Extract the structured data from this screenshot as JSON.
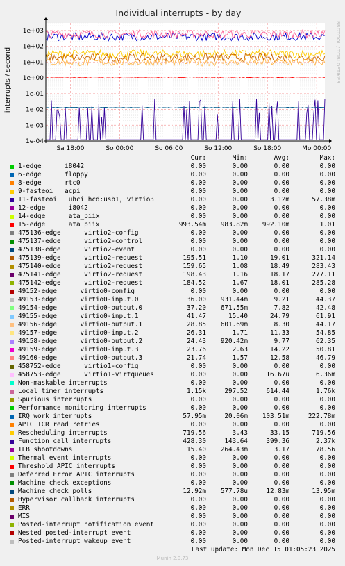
{
  "chart_data": {
    "type": "line",
    "title": "Individual interrupts - by day",
    "ylabel": "interrupts / second",
    "yscale": "log",
    "ylim": [
      0.0001,
      3000
    ],
    "yticks": [
      "1e-04",
      "1e-03",
      "1e-02",
      "1e-01",
      "1e+00",
      "1e+01",
      "1e+02",
      "1e+03"
    ],
    "xticks": [
      "Sa 18:00",
      "So 00:00",
      "So 06:00",
      "So 12:00",
      "So 18:00",
      "Mo 00:00"
    ],
    "xtick_hours": [
      -30,
      -24,
      -18,
      -12,
      -6,
      0
    ],
    "xlim_hours": [
      -33,
      1
    ],
    "approx_series_levels": [
      {
        "name": "15-edge ata_piix",
        "level": 1.0,
        "color": "#ff0000"
      },
      {
        "name": "11-fasteoi uhci_hcd:usb1, virtio3",
        "level": 0.003,
        "color": "#330099",
        "spiky": true
      },
      {
        "name": "Machine check polls",
        "level": 0.013,
        "color": "#005a8c"
      },
      {
        "name": "Function call interrupts",
        "level": 400,
        "color": "#0000cc"
      },
      {
        "name": "Local timer interrupts",
        "level": 600,
        "color": "#ff6699"
      },
      {
        "name": "Rescheduling interrupts",
        "level": 33,
        "color": "#ffcc00"
      },
      {
        "name": "virtio2-request",
        "level": 19,
        "color": "#cc6600"
      },
      {
        "name": "virtio0-input/output",
        "level": 10,
        "color": "#ffb84d"
      }
    ]
  },
  "side_text": "RRDTOOL / TOBI OETIKER",
  "legend_header": {
    "cur": "Cur:",
    "min": "Min:",
    "avg": "Avg:",
    "max": "Max:"
  },
  "legend": [
    {
      "label": "1-edge      i8042",
      "color": "#00cc00",
      "cur": "0.00",
      "min": "0.00",
      "avg": "0.00",
      "max": "0.00"
    },
    {
      "label": "6-edge      floppy",
      "color": "#0066b3",
      "cur": "0.00",
      "min": "0.00",
      "avg": "0.00",
      "max": "0.00"
    },
    {
      "label": "8-edge      rtc0",
      "color": "#ff8000",
      "cur": "0.00",
      "min": "0.00",
      "avg": "0.00",
      "max": "0.00"
    },
    {
      "label": "9-fasteoi   acpi",
      "color": "#ffcc00",
      "cur": "0.00",
      "min": "0.00",
      "avg": "0.00",
      "max": "0.00"
    },
    {
      "label": "11-fasteoi   uhci_hcd:usb1, virtio3",
      "color": "#330099",
      "cur": "0.00",
      "min": "0.00",
      "avg": "3.12m",
      "max": "57.38m"
    },
    {
      "label": "12-edge      i8042",
      "color": "#990099",
      "cur": "0.00",
      "min": "0.00",
      "avg": "0.00",
      "max": "0.00"
    },
    {
      "label": "14-edge      ata_piix",
      "color": "#ccff00",
      "cur": "0.00",
      "min": "0.00",
      "avg": "0.00",
      "max": "0.00"
    },
    {
      "label": "15-edge      ata_piix",
      "color": "#ff0000",
      "cur": "993.54m",
      "min": "983.82m",
      "avg": "992.10m",
      "max": "1.01"
    },
    {
      "label": "475136-edge      virtio2-config",
      "color": "#808080",
      "cur": "0.00",
      "min": "0.00",
      "avg": "0.00",
      "max": "0.00"
    },
    {
      "label": "475137-edge      virtio2-control",
      "color": "#008f00",
      "cur": "0.00",
      "min": "0.00",
      "avg": "0.00",
      "max": "0.00"
    },
    {
      "label": "475138-edge      virtio2-event",
      "color": "#00487d",
      "cur": "0.00",
      "min": "0.00",
      "avg": "0.00",
      "max": "0.00"
    },
    {
      "label": "475139-edge      virtio2-request",
      "color": "#b35a00",
      "cur": "195.51",
      "min": "1.10",
      "avg": "19.01",
      "max": "321.14"
    },
    {
      "label": "475140-edge      virtio2-request",
      "color": "#b38f00",
      "cur": "159.65",
      "min": "1.08",
      "avg": "18.49",
      "max": "283.43"
    },
    {
      "label": "475141-edge      virtio2-request",
      "color": "#6b006b",
      "cur": "198.43",
      "min": "1.16",
      "avg": "18.17",
      "max": "277.11"
    },
    {
      "label": "475142-edge      virtio2-request",
      "color": "#8fb300",
      "cur": "184.52",
      "min": "1.67",
      "avg": "18.01",
      "max": "285.28"
    },
    {
      "label": "49152-edge      virtio0-config",
      "color": "#b30000",
      "cur": "0.00",
      "min": "0.00",
      "avg": "0.00",
      "max": "0.00"
    },
    {
      "label": "49153-edge      virtio0-input.0",
      "color": "#bebebe",
      "cur": "36.00",
      "min": "931.44m",
      "avg": "9.21",
      "max": "44.37"
    },
    {
      "label": "49154-edge      virtio0-output.0",
      "color": "#80ff80",
      "cur": "37.20",
      "min": "671.55m",
      "avg": "7.82",
      "max": "42.48"
    },
    {
      "label": "49155-edge      virtio0-input.1",
      "color": "#80c9ff",
      "cur": "41.47",
      "min": "15.40",
      "avg": "24.79",
      "max": "61.91"
    },
    {
      "label": "49156-edge      virtio0-output.1",
      "color": "#ffc080",
      "cur": "28.85",
      "min": "601.69m",
      "avg": "8.30",
      "max": "44.17"
    },
    {
      "label": "49157-edge      virtio0-input.2",
      "color": "#ffe680",
      "cur": "26.31",
      "min": "1.71",
      "avg": "11.33",
      "max": "54.85"
    },
    {
      "label": "49158-edge      virtio0-output.2",
      "color": "#aa80ff",
      "cur": "24.43",
      "min": "920.42m",
      "avg": "9.77",
      "max": "62.35"
    },
    {
      "label": "49159-edge      virtio0-input.3",
      "color": "#ee00cc",
      "cur": "23.76",
      "min": "2.63",
      "avg": "14.22",
      "max": "50.81"
    },
    {
      "label": "49160-edge      virtio0-output.3",
      "color": "#ff8080",
      "cur": "21.74",
      "min": "1.57",
      "avg": "12.58",
      "max": "46.79"
    },
    {
      "label": "458752-edge      virtio1-config",
      "color": "#666600",
      "cur": "0.00",
      "min": "0.00",
      "avg": "0.00",
      "max": "0.00"
    },
    {
      "label": "458753-edge      virtio1-virtqueues",
      "color": "#ffbfff",
      "cur": "0.00",
      "min": "0.00",
      "avg": "16.67u",
      "max": "6.36m"
    },
    {
      "label": "Non-maskable interrupts",
      "color": "#00ffcc",
      "cur": "0.00",
      "min": "0.00",
      "avg": "0.00",
      "max": "0.00"
    },
    {
      "label": "Local timer interrupts",
      "color": "#cc6699",
      "cur": "1.15k",
      "min": "297.52",
      "avg": "614.44",
      "max": "1.76k"
    },
    {
      "label": "Spurious interrupts",
      "color": "#999900",
      "cur": "0.00",
      "min": "0.00",
      "avg": "0.00",
      "max": "0.00"
    },
    {
      "label": "Performance monitoring interrupts",
      "color": "#00cc00",
      "cur": "0.00",
      "min": "0.00",
      "avg": "0.00",
      "max": "0.00"
    },
    {
      "label": "IRQ work interrupts",
      "color": "#0066b3",
      "cur": "57.95m",
      "min": "20.06m",
      "avg": "103.51m",
      "max": "222.78m"
    },
    {
      "label": "APIC ICR read retries",
      "color": "#ff8000",
      "cur": "0.00",
      "min": "0.00",
      "avg": "0.00",
      "max": "0.00"
    },
    {
      "label": "Rescheduling interrupts",
      "color": "#ffcc00",
      "cur": "719.56",
      "min": "3.43",
      "avg": "33.15",
      "max": "719.56"
    },
    {
      "label": "Function call interrupts",
      "color": "#330099",
      "cur": "428.30",
      "min": "143.64",
      "avg": "399.36",
      "max": "2.37k"
    },
    {
      "label": "TLB shootdowns",
      "color": "#990099",
      "cur": "15.40",
      "min": "264.43m",
      "avg": "3.17",
      "max": "78.56"
    },
    {
      "label": "Thermal event interrupts",
      "color": "#ccff00",
      "cur": "0.00",
      "min": "0.00",
      "avg": "0.00",
      "max": "0.00"
    },
    {
      "label": "Threshold APIC interrupts",
      "color": "#ff0000",
      "cur": "0.00",
      "min": "0.00",
      "avg": "0.00",
      "max": "0.00"
    },
    {
      "label": "Deferred Error APIC interrupts",
      "color": "#808080",
      "cur": "0.00",
      "min": "0.00",
      "avg": "0.00",
      "max": "0.00"
    },
    {
      "label": "Machine check exceptions",
      "color": "#008f00",
      "cur": "0.00",
      "min": "0.00",
      "avg": "0.00",
      "max": "0.00"
    },
    {
      "label": "Machine check polls",
      "color": "#00487d",
      "cur": "12.92m",
      "min": "577.78u",
      "avg": "12.83m",
      "max": "13.95m"
    },
    {
      "label": "Hypervisor callback interrupts",
      "color": "#b35a00",
      "cur": "0.00",
      "min": "0.00",
      "avg": "0.00",
      "max": "0.00"
    },
    {
      "label": "ERR",
      "color": "#b38f00",
      "cur": "0.00",
      "min": "0.00",
      "avg": "0.00",
      "max": "0.00"
    },
    {
      "label": "MIS",
      "color": "#6b006b",
      "cur": "0.00",
      "min": "0.00",
      "avg": "0.00",
      "max": "0.00"
    },
    {
      "label": "Posted-interrupt notification event",
      "color": "#8fb300",
      "cur": "0.00",
      "min": "0.00",
      "avg": "0.00",
      "max": "0.00"
    },
    {
      "label": "Nested posted-interrupt event",
      "color": "#b30000",
      "cur": "0.00",
      "min": "0.00",
      "avg": "0.00",
      "max": "0.00"
    },
    {
      "label": "Posted-interrupt wakeup event",
      "color": "#bebebe",
      "cur": "0.00",
      "min": "0.00",
      "avg": "0.00",
      "max": "0.00"
    }
  ],
  "last_update": "Last update: Mon Dec 15 01:05:23 2025",
  "footer": "Munin 2.0.73"
}
